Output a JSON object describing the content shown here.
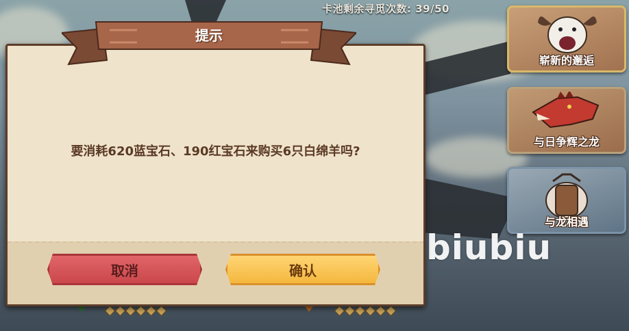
{
  "hud": {
    "draw_counter": "卡池剩余寻觅次数: 39/50"
  },
  "event_cards": [
    {
      "label": "崭新的邂逅",
      "icon": "goat-head-icon"
    },
    {
      "label": "与日争辉之龙",
      "icon": "red-dragon-icon"
    },
    {
      "label": "与龙相遇",
      "icon": "dragon-card-icon"
    }
  ],
  "dialog": {
    "title": "提示",
    "message": "要消耗620蓝宝石、190红宝石来购买6只白绵羊吗?",
    "cancel_label": "取消",
    "confirm_label": "确认"
  },
  "watermark": "biubiu",
  "colors": {
    "dialog_bg": "#f0e3cb",
    "title_banner": "#a7654a",
    "message_text": "#5a3a26",
    "cancel_button": "#d85457",
    "confirm_button": "#f7c24f"
  }
}
